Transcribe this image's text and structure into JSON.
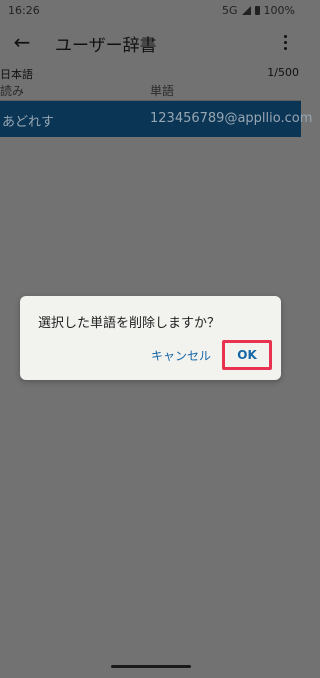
{
  "status_bar": {
    "time": "16:26",
    "network": "5G",
    "battery": "100%"
  },
  "app_bar": {
    "title": "ユーザー辞書",
    "back_icon": "arrow-left-icon",
    "menu_icon": "more-vert-icon"
  },
  "dictionary": {
    "language": "日本語",
    "count": "1/500",
    "columns": {
      "reading": "読み",
      "word": "単語"
    },
    "entries": [
      {
        "reading": "あどれす",
        "word": "123456789@appllio.com",
        "selected": true
      }
    ]
  },
  "dialog": {
    "message": "選択した単語を削除しますか？",
    "cancel_label": "キャンセル",
    "ok_label": "OK"
  },
  "colors": {
    "overlay": "#727272",
    "selected_row": "#0b3554",
    "dialog_bg": "#f2f2ef",
    "button_text": "#1565a6",
    "highlight_border": "#e8324f"
  }
}
